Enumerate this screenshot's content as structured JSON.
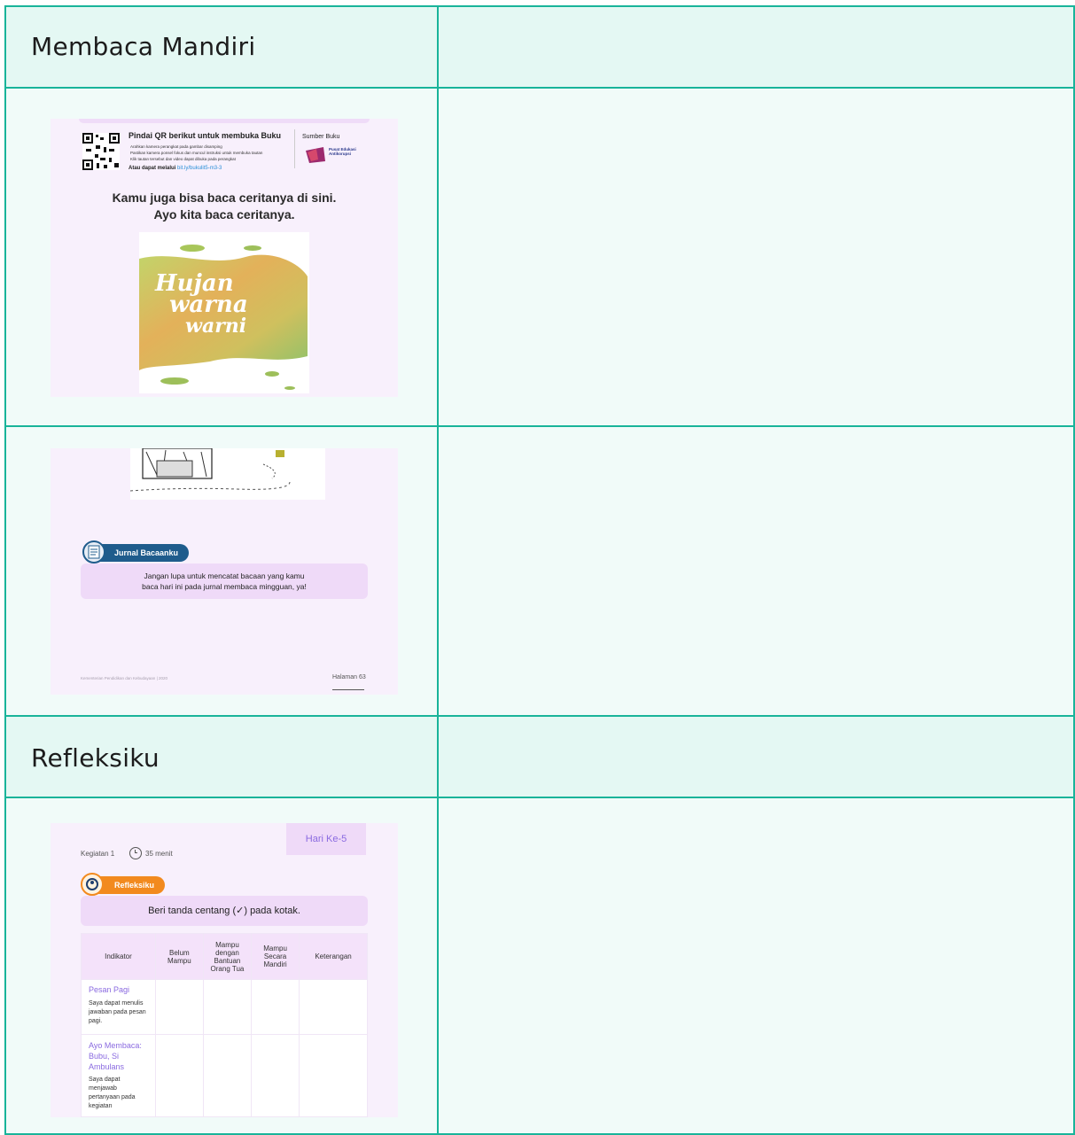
{
  "sections": {
    "membaca_title": "Membaca Mandiri",
    "refleksi_title": "Refleksiku"
  },
  "page1": {
    "qr_heading": "Pindai QR berikut untuk membuka Buku",
    "qr_steps": [
      "Arahkan kamera perangkat pada gambar disamping",
      "Pastikan kamera ponsel fokus dan muncul instruksi untuk membuka tautan",
      "Klik tautan tersebut dan video dapat dibuka pada perangkat"
    ],
    "qr_link_prefix": "Atau dapat melalui",
    "qr_link": "bit.ly/bukulit5-m3-3",
    "source_label": "Sumber Buku",
    "source_logo_text": "Pusat Edukasi Antikorupsi",
    "headline_line1": "Kamu juga bisa baca ceritanya di sini.",
    "headline_line2": "Ayo kita baca ceritanya.",
    "cover_title_line1": "Hujan",
    "cover_title_line2": "warna",
    "cover_title_line3": "warni"
  },
  "page2": {
    "badge": "Jurnal Bacaanku",
    "note_line1": "Jangan lupa untuk mencatat bacaan yang kamu",
    "note_line2": "baca hari ini pada jurnal membaca mingguan, ya!",
    "footer_left": "Kementerian Pendidikan dan Kebudayaan | 2020",
    "footer_right": "Halaman 63"
  },
  "page3": {
    "day_tag": "Hari Ke-5",
    "activity": "Kegiatan 1",
    "duration": "35 menit",
    "badge": "Refleksiku",
    "instruction": "Beri tanda centang (✓) pada kotak.",
    "columns": [
      "Indikator",
      "Belum Mampu",
      "Mampu dengan Bantuan Orang Tua",
      "Mampu Secara Mandiri",
      "Keterangan"
    ],
    "rows": [
      {
        "title": "Pesan Pagi",
        "desc": "Saya dapat menulis jawaban pada pesan pagi."
      },
      {
        "title": "Ayo Membaca: Bubu, Si Ambulans",
        "desc": "Saya dapat menjawab pertanyaan pada kegiatan"
      }
    ]
  },
  "colors": {
    "border": "#19b49a",
    "header_bg": "#e4f8f3",
    "cell_bg": "#f1fbf9",
    "badge_blue": "#1f5c8c",
    "badge_orange": "#f28a1e"
  }
}
